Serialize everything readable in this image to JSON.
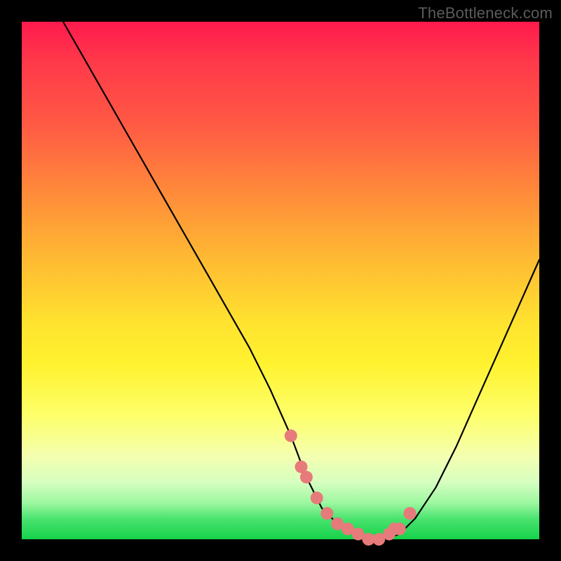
{
  "watermark": "TheBottleneck.com",
  "colors": {
    "background": "#000000",
    "curve_stroke": "#000000",
    "marker_fill": "#e77a7a",
    "marker_stroke": "#d86a6a"
  },
  "chart_data": {
    "type": "line",
    "title": "",
    "xlabel": "",
    "ylabel": "",
    "xlim": [
      0,
      100
    ],
    "ylim": [
      0,
      100
    ],
    "grid": false,
    "annotations": [
      "TheBottleneck.com"
    ],
    "series": [
      {
        "name": "bottleneck-curve",
        "x": [
          8,
          12,
          16,
          20,
          24,
          28,
          32,
          36,
          40,
          44,
          48,
          52,
          55,
          58,
          61,
          64,
          67,
          70,
          73,
          76,
          80,
          84,
          88,
          92,
          96,
          100
        ],
        "y": [
          100,
          93,
          86,
          79,
          72,
          65,
          58,
          51,
          44,
          37,
          29,
          20,
          12,
          6,
          3,
          1,
          0,
          0,
          1,
          4,
          10,
          18,
          27,
          36,
          45,
          54
        ]
      }
    ],
    "markers": {
      "name": "highlight-dots",
      "x": [
        52,
        54,
        55,
        57,
        59,
        61,
        63,
        65,
        67,
        69,
        71,
        72,
        73,
        75
      ],
      "y": [
        20,
        14,
        12,
        8,
        5,
        3,
        2,
        1,
        0,
        0,
        1,
        2,
        2,
        5
      ]
    }
  }
}
